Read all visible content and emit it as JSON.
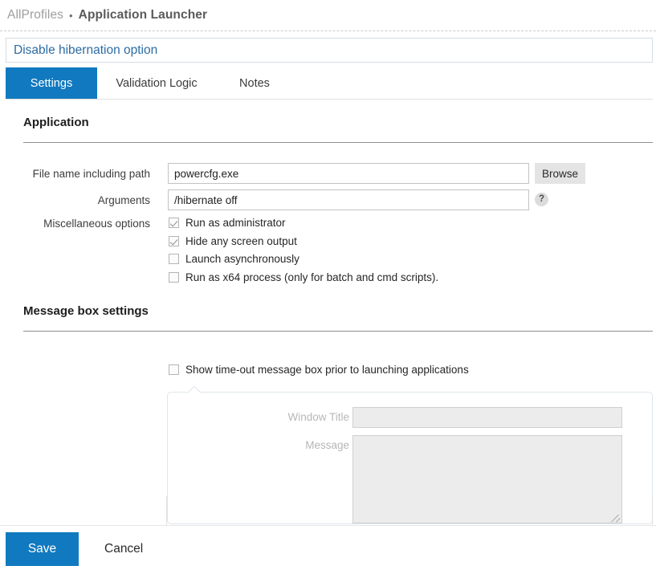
{
  "breadcrumb": {
    "root": "AllProfiles",
    "separator": "•",
    "leaf": "Application Launcher"
  },
  "title": {
    "text": "Disable hibernation option"
  },
  "tabs": [
    {
      "label": "Settings",
      "active": true
    },
    {
      "label": "Validation Logic",
      "active": false
    },
    {
      "label": "Notes",
      "active": false
    }
  ],
  "sections": {
    "application": {
      "heading": "Application",
      "fields": {
        "file_name_label": "File name including path",
        "file_name_value": "powercfg.exe",
        "file_name_placeholder": "",
        "browse_label": "Browse",
        "arguments_label": "Arguments",
        "arguments_value": "/hibernate off",
        "arguments_placeholder": "",
        "help_icon": "question-mark-icon",
        "help_glyph": "?",
        "misc_label": "Miscellaneous options"
      },
      "checkboxes": [
        {
          "label": "Run as administrator",
          "checked": true
        },
        {
          "label": "Hide any screen output",
          "checked": true
        },
        {
          "label": "Launch asynchronously",
          "checked": false
        },
        {
          "label": "Run as x64 process (only for batch and cmd scripts).",
          "checked": false
        }
      ]
    },
    "message_box": {
      "heading": "Message box settings",
      "show_timeout": {
        "label": "Show time-out message box prior to launching applications",
        "checked": false
      },
      "panel": {
        "window_title_label": "Window Title",
        "window_title_value": "",
        "window_title_placeholder": "",
        "message_label": "Message",
        "message_value": "",
        "message_placeholder": ""
      }
    }
  },
  "footer": {
    "save_label": "Save",
    "cancel_label": "Cancel"
  },
  "colors": {
    "accent_blue": "#1179bf",
    "title_blue": "#2b6ca3",
    "breadcrumb_gray": "#9a9a9a",
    "disabled_field_bg": "#ececec",
    "rule_gray": "#8e8e8e"
  }
}
